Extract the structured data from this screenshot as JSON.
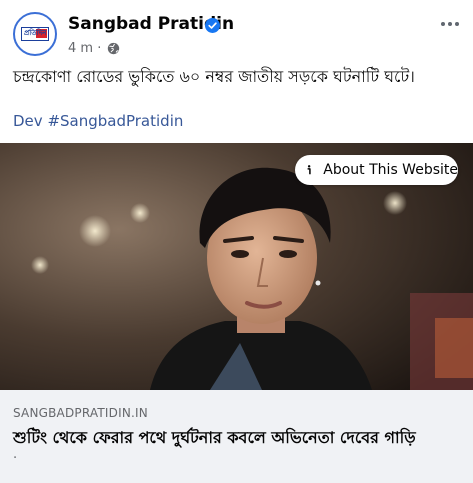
{
  "post": {
    "page_name": "Sangbad Pratidin",
    "avatar_logo_text": "প্রতিদিন",
    "timestamp": "4 m",
    "meta_separator": "·",
    "text": "চন্দ্রকোণা রোডের ভুকিতে ৬০ নম্বর জাতীয় সড়কে ঘটনাটি ঘটে।",
    "hashtags": [
      "Dev",
      "#SangbadPratidin"
    ]
  },
  "media": {
    "about_button_label": "About This Website"
  },
  "link_preview": {
    "domain": "SANGBADPRATIDIN.IN",
    "title": "শুটিং থেকে ফেরার পথে দুর্ঘটনার কবলে অভিনেতা দেবের গাড়ি",
    "description": "."
  },
  "colors": {
    "accent_link": "#385898",
    "verified_badge": "#1877f2",
    "card_background": "#f0f2f5",
    "secondary_text": "#65676b"
  },
  "icons": {
    "verified": "verified-badge-icon",
    "audience": "globe-icon",
    "menu": "more-options-icon",
    "info": "info-icon"
  }
}
